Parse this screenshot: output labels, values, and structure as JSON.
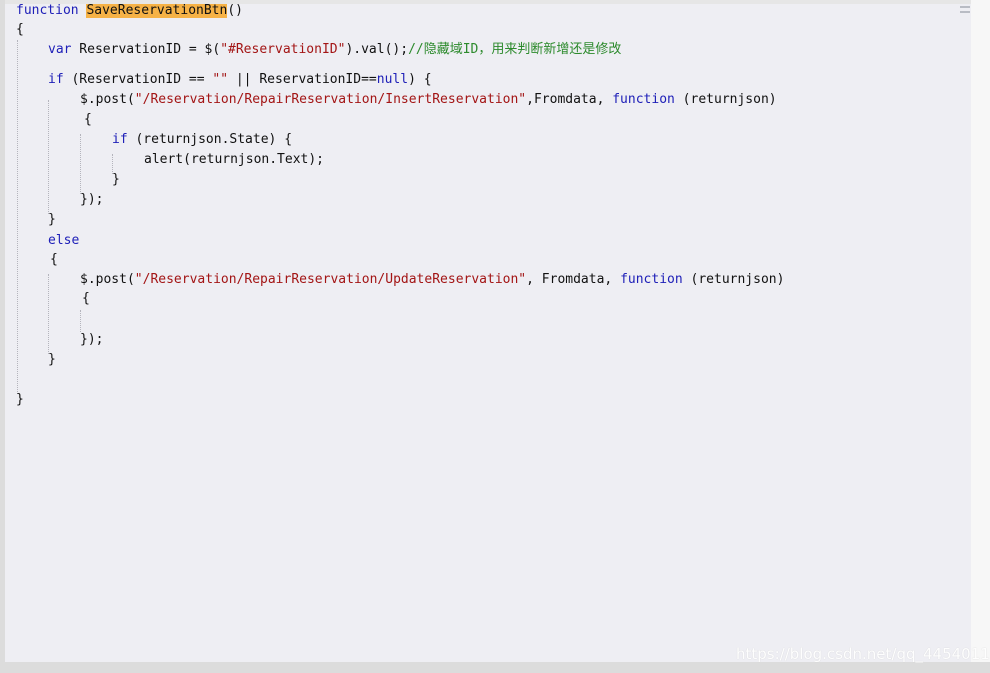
{
  "editor": {
    "lines": {
      "l1": {
        "a": "function",
        "b": "SaveReservationBtn",
        "c": "()"
      },
      "l2": {
        "a": "{"
      },
      "l3": {
        "a": "var",
        "b": " ReservationID = $(",
        "c": "\"#ReservationID\"",
        "d": ").val();",
        "e": "//隐藏域ID，用来判断新增还是修改"
      },
      "l4": {
        "a": "if",
        "b": " (ReservationID == ",
        "c": "\"\"",
        "d": " || ReservationID==",
        "e": "null",
        "f": ") {"
      },
      "l5": {
        "a": "$.post(",
        "b": "\"/Reservation/RepairReservation/InsertReservation\"",
        "c": ",Fromdata, ",
        "d": "function",
        "e": " (returnjson)"
      },
      "l6": {
        "a": "{"
      },
      "l7": {
        "a": "if",
        "b": " (returnjson.State) {"
      },
      "l8": {
        "a": "alert(returnjson.Text);"
      },
      "l9": {
        "a": "}"
      },
      "l10": {
        "a": "});"
      },
      "l11": {
        "a": "}"
      },
      "l12": {
        "a": "else"
      },
      "l13": {
        "a": "{"
      },
      "l14": {
        "a": "$.post(",
        "b": "\"/Reservation/RepairReservation/UpdateReservation\"",
        "c": ", Fromdata, ",
        "d": "function",
        "e": " (returnjson)"
      },
      "l15": {
        "a": "{"
      },
      "l16": {
        "a": "});"
      },
      "l17": {
        "a": "}"
      },
      "l18": {
        "a": "}"
      }
    }
  },
  "watermark": "https://blog.csdn.net/qq_44540112",
  "colors": {
    "background": "#eeeef3",
    "keyword": "#1f20b8",
    "string": "#a31515",
    "comment": "#2c8a2c",
    "highlight": "#f6b246"
  }
}
